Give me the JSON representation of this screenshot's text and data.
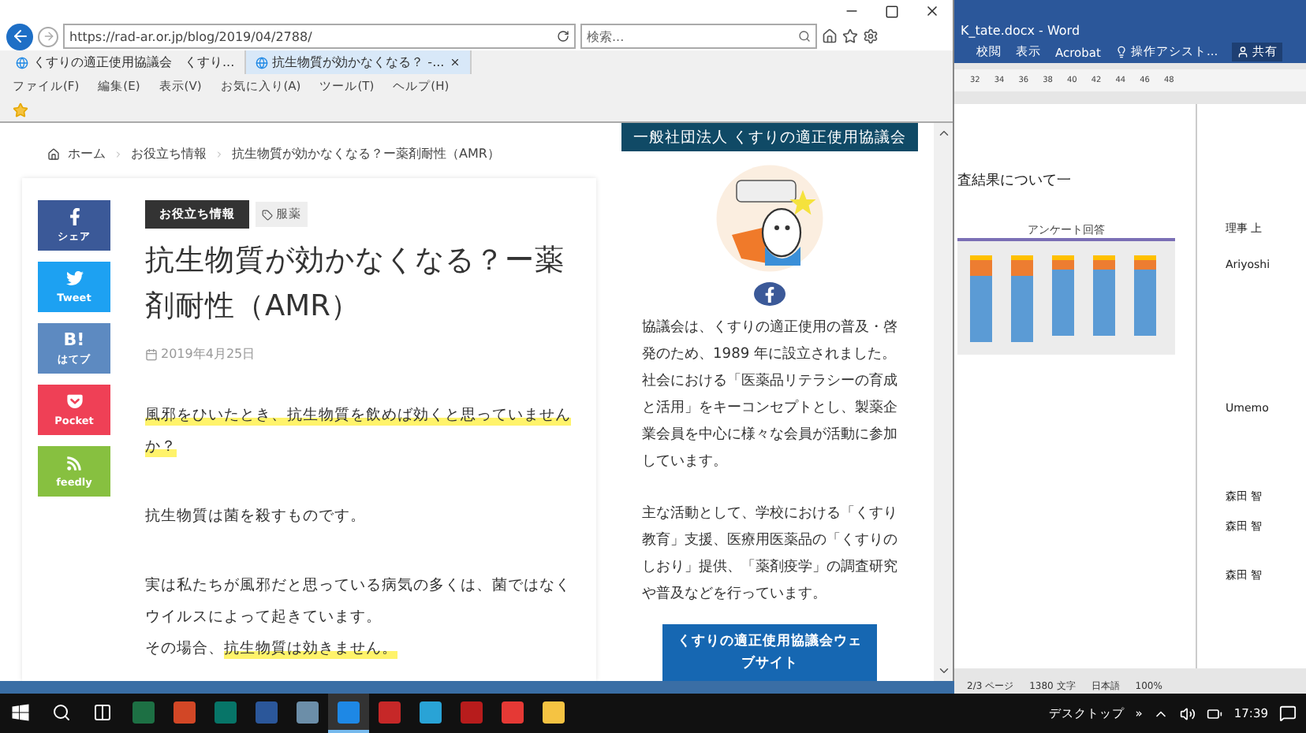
{
  "ie_window": {
    "address": "https://rad-ar.or.jp/blog/2019/04/2788/",
    "search_placeholder": "検索...",
    "tabs": [
      {
        "label": "くすりの適正使用協議会　くすり...",
        "selected": false
      },
      {
        "label": "抗生物質が効かなくなる？ -...",
        "selected": true
      }
    ],
    "menu": [
      "ファイル(F)",
      "編集(E)",
      "表示(V)",
      "お気に入り(A)",
      "ツール(T)",
      "ヘルプ(H)"
    ],
    "breadcrumb": [
      "ホーム",
      "お役立ち情報",
      "抗生物質が効かなくなる？ー薬剤耐性（AMR）"
    ],
    "share_buttons": [
      {
        "kind": "facebook",
        "label": "シェア"
      },
      {
        "kind": "twitter",
        "label": "Tweet"
      },
      {
        "kind": "hatena",
        "mark": "B!",
        "label": "はてブ"
      },
      {
        "kind": "pocket",
        "label": "Pocket"
      },
      {
        "kind": "feedly",
        "label": "feedly"
      }
    ],
    "article": {
      "category": "お役立ち情報",
      "tag": "服薬",
      "title": "抗生物質が効かなくなる？ー薬剤耐性（AMR）",
      "date": "2019年4月25日",
      "paragraphs": [
        [
          [
            {
              "text": "風邪をひいたとき、抗生物質を飲めば効くと思っていませんか？",
              "highlighted": true
            }
          ]
        ],
        [
          [
            {
              "text": "抗生物質は菌を殺すものです。",
              "highlighted": false
            }
          ]
        ],
        [
          [
            {
              "text": "実は私たちが風邪だと思っている病気の多くは、菌ではなくウイルスによって起きています。",
              "highlighted": false
            }
          ],
          [
            {
              "text": "その場合、",
              "highlighted": false
            },
            {
              "text": "抗生物質は効きません。",
              "highlighted": true
            }
          ]
        ]
      ]
    },
    "sidebar": {
      "heading": "一般社団法人 くすりの適正使用協議会",
      "paragraphs": [
        "協議会は、くすりの適正使用の普及・啓発のため、1989 年に設立されました。社会における「医薬品リテラシーの育成と活用」をキーコンセプトとし、製薬企業会員を中心に様々な会員が活動に参加しています。",
        "主な活動として、学校における「くすり教育」支援、医療用医薬品の「くすりのしおり」提供、「薬剤疫学」の調査研究や普及などを行っています。"
      ],
      "button": "くすりの適正使用協議会ウェブサイト"
    }
  },
  "word_window": {
    "title": "K_tate.docx - Word",
    "ribbon_tabs": [
      "校閲",
      "表示",
      "Acrobat"
    ],
    "tell_me": "操作アシスト...",
    "share": "共有",
    "ruler": [
      "32",
      "34",
      "36",
      "38",
      "40",
      "42",
      "44",
      "46",
      "48"
    ],
    "heading": "査結果について一",
    "figure_title": "アンケート回答",
    "comments": [
      "理事 上",
      "Ariyoshi",
      "Umemo",
      "森田 智",
      "森田 智",
      "森田 智"
    ],
    "status": {
      "page": "2/3 ページ",
      "words": "1380 文字",
      "language": "日本語",
      "zoom": "100%"
    }
  },
  "taskbar": {
    "apps": [
      {
        "kind": "excel",
        "selected": false
      },
      {
        "kind": "powerpoint",
        "selected": false
      },
      {
        "kind": "publisher",
        "selected": false
      },
      {
        "kind": "word",
        "selected": false
      },
      {
        "kind": "notes",
        "selected": false
      },
      {
        "kind": "browser",
        "selected": true
      },
      {
        "kind": "pdf",
        "selected": false
      },
      {
        "kind": "globe",
        "selected": false
      },
      {
        "kind": "acrobat",
        "selected": false
      },
      {
        "kind": "reader",
        "selected": false
      },
      {
        "kind": "folder",
        "selected": false
      }
    ],
    "desktop_label": "デスクトップ",
    "overflow": "»",
    "time": "17:39"
  }
}
